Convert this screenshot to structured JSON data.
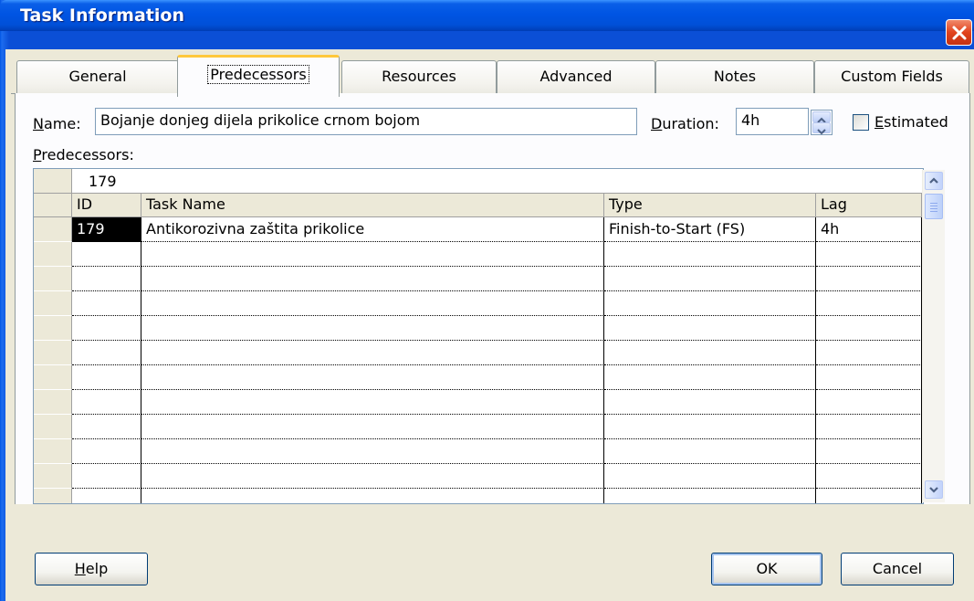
{
  "window": {
    "title": "Task Information"
  },
  "tabs": [
    {
      "label": "General",
      "active": false
    },
    {
      "label": "Predecessors",
      "active": true
    },
    {
      "label": "Resources",
      "active": false
    },
    {
      "label": "Advanced",
      "active": false
    },
    {
      "label": "Notes",
      "active": false
    },
    {
      "label": "Custom Fields",
      "active": false
    }
  ],
  "form": {
    "name_label": "Name:",
    "name_value": "Bojanje donjeg dijela prikolice crnom bojom",
    "duration_label": "Duration:",
    "duration_value": "4h",
    "estimated_label": "Estimated",
    "estimated_checked": false,
    "predecessors_label": "Predecessors:"
  },
  "grid": {
    "entry_value": "179",
    "columns": [
      "ID",
      "Task Name",
      "Type",
      "Lag"
    ],
    "rows": [
      {
        "id": "179",
        "task_name": "Antikorozivna zaštita prikolice",
        "type": "Finish-to-Start (FS)",
        "lag": "4h"
      }
    ]
  },
  "buttons": {
    "help": "Help",
    "ok": "OK",
    "cancel": "Cancel"
  },
  "colors": {
    "titlebar": "#0054e3",
    "dialog_bg": "#ece9d8",
    "tab_highlight": "#ffc83c",
    "close": "#e1421c"
  },
  "icons": {
    "close": "close-icon",
    "spin_up": "chevron-up-icon",
    "spin_down": "chevron-down-icon"
  }
}
